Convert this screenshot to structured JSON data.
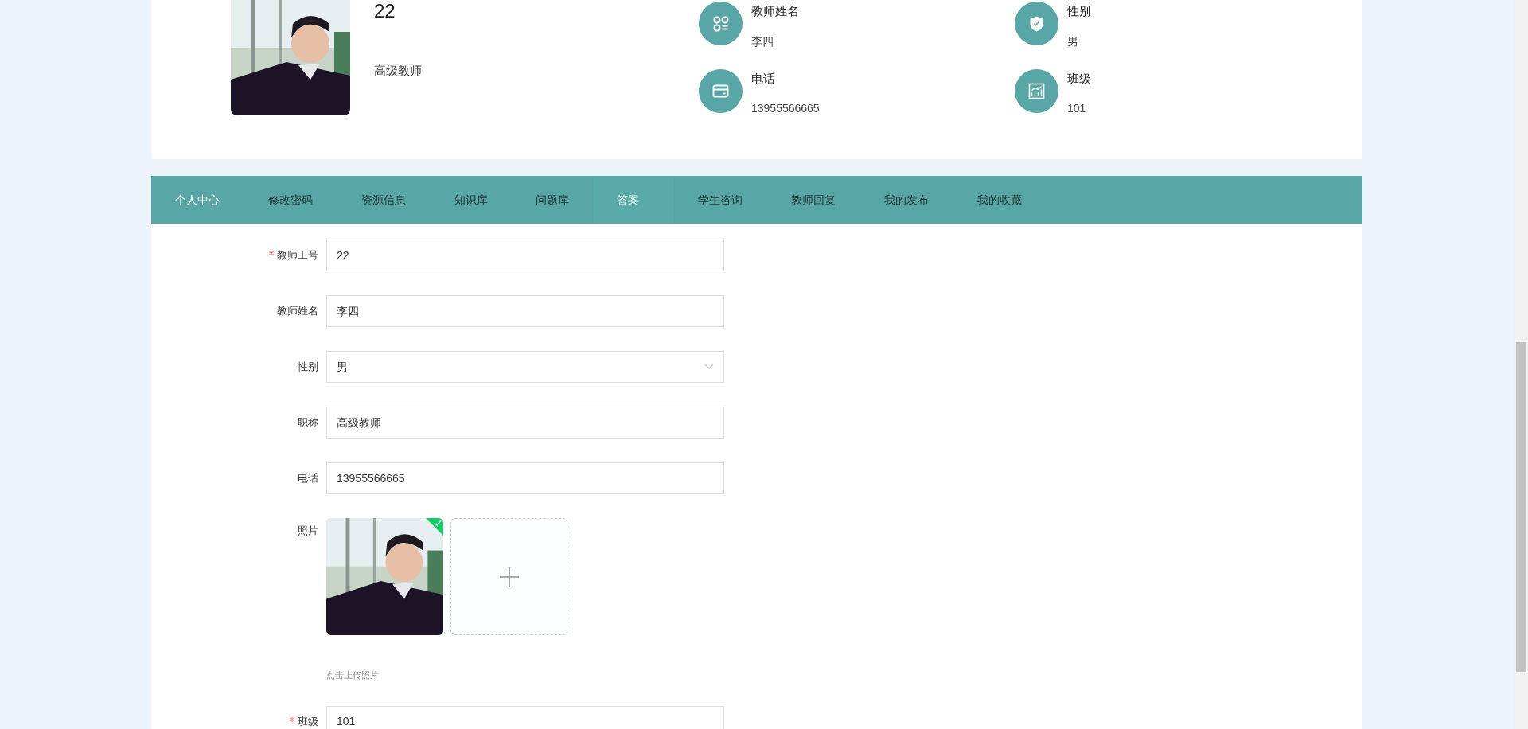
{
  "profile": {
    "number": "22",
    "title": "高级教师",
    "info": [
      {
        "kind": "grid",
        "label": "教师姓名",
        "value": "李四"
      },
      {
        "kind": "shield",
        "label": "性别",
        "value": "男"
      },
      {
        "kind": "card",
        "label": "电话",
        "value": "13955566665"
      },
      {
        "kind": "chart",
        "label": "班级",
        "value": "101"
      }
    ]
  },
  "nav": [
    {
      "label": "个人中心",
      "selected": true,
      "hovered": false
    },
    {
      "label": "修改密码",
      "selected": false,
      "hovered": false
    },
    {
      "label": "资源信息",
      "selected": false,
      "hovered": false
    },
    {
      "label": "知识库",
      "selected": false,
      "hovered": false
    },
    {
      "label": "问题库",
      "selected": false,
      "hovered": false
    },
    {
      "label": "答案",
      "selected": false,
      "hovered": true
    },
    {
      "label": "学生咨询",
      "selected": false,
      "hovered": false
    },
    {
      "label": "教师回复",
      "selected": false,
      "hovered": false
    },
    {
      "label": "我的发布",
      "selected": false,
      "hovered": false
    },
    {
      "label": "我的收藏",
      "selected": false,
      "hovered": false
    }
  ],
  "form": [
    {
      "kind": "text",
      "label": "教师工号",
      "required": true,
      "value": "22"
    },
    {
      "kind": "text",
      "label": "教师姓名",
      "required": false,
      "value": "李四"
    },
    {
      "kind": "select",
      "label": "性别",
      "required": false,
      "value": "男"
    },
    {
      "kind": "text",
      "label": "职称",
      "required": false,
      "value": "高级教师"
    },
    {
      "kind": "text",
      "label": "电话",
      "required": false,
      "value": "13955566665"
    },
    {
      "kind": "upload",
      "label": "照片",
      "required": false,
      "uploaded": true,
      "hint": "点击上传照片"
    },
    {
      "kind": "text",
      "label": "班级",
      "required": true,
      "value": "101"
    }
  ]
}
